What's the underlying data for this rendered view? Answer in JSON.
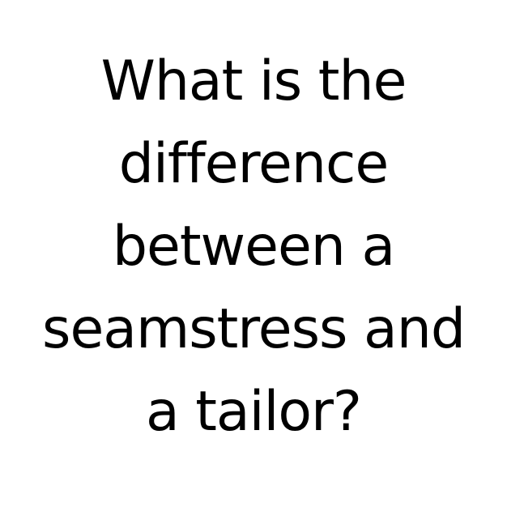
{
  "question": {
    "lines": [
      "What is the",
      "difference",
      "between a",
      "seamstress and",
      "a tailor?"
    ]
  },
  "colors": {
    "background": "#ffffff",
    "text": "#000000"
  }
}
